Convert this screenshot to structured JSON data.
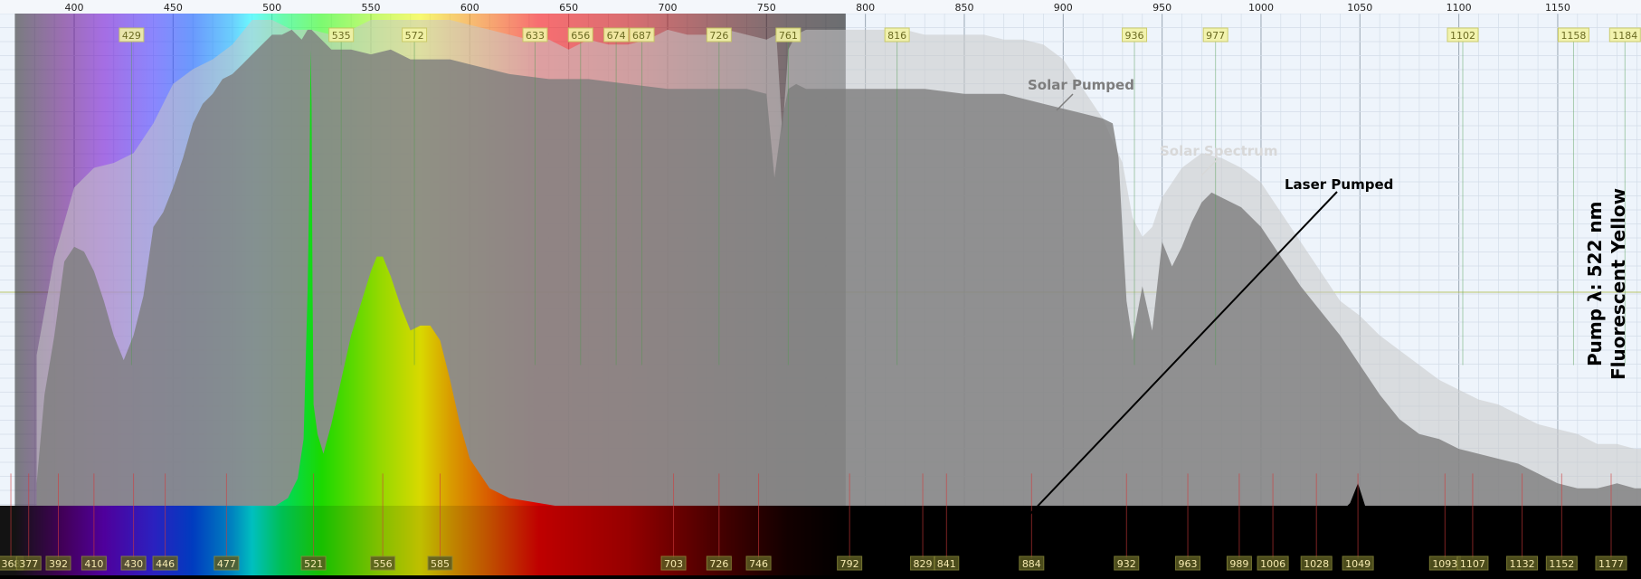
{
  "chart_data": {
    "type": "area",
    "title": "",
    "xlabel": "",
    "ylabel": "",
    "xlim": [
      381,
      1189
    ],
    "ylim": [
      0,
      1
    ],
    "xticks": [
      400,
      450,
      500,
      550,
      600,
      650,
      700,
      750,
      800,
      850,
      900,
      950,
      1000,
      1050,
      1100,
      1150
    ],
    "grid": true,
    "top_peak_labels": [
      429,
      535,
      572,
      633,
      656,
      674,
      687,
      726,
      761,
      816,
      936,
      977,
      1102,
      1158,
      1184
    ],
    "bottom_peak_labels": [
      368,
      377,
      392,
      410,
      430,
      446,
      477,
      521,
      556,
      585,
      703,
      726,
      746,
      792,
      829,
      841,
      884,
      932,
      963,
      989,
      1006,
      1028,
      1049,
      1093,
      1107,
      1132,
      1152,
      1177
    ],
    "series": [
      {
        "name": "Solar Spectrum",
        "color": "#c8c8c8",
        "x": [
          381,
          390,
          400,
          410,
          420,
          430,
          440,
          450,
          460,
          470,
          480,
          490,
          500,
          510,
          520,
          530,
          540,
          550,
          560,
          570,
          580,
          590,
          600,
          610,
          620,
          630,
          640,
          650,
          660,
          670,
          680,
          690,
          700,
          710,
          720,
          730,
          740,
          750,
          755,
          758,
          761,
          765,
          770,
          780,
          790,
          800,
          810,
          820,
          830,
          840,
          850,
          860,
          870,
          880,
          890,
          900,
          910,
          920,
          930,
          935,
          940,
          945,
          950,
          960,
          970,
          980,
          990,
          1000,
          1010,
          1020,
          1030,
          1040,
          1050,
          1060,
          1070,
          1080,
          1090,
          1100,
          1110,
          1120,
          1130,
          1140,
          1150,
          1160,
          1170,
          1180,
          1189
        ],
        "values": [
          0.32,
          0.52,
          0.66,
          0.7,
          0.71,
          0.73,
          0.79,
          0.87,
          0.9,
          0.92,
          0.95,
          1.0,
          1.0,
          0.98,
          0.98,
          0.97,
          0.98,
          1.0,
          1.0,
          1.0,
          1.0,
          1.0,
          0.99,
          0.98,
          0.97,
          0.96,
          0.96,
          0.94,
          0.96,
          0.95,
          0.95,
          0.96,
          0.98,
          0.97,
          0.97,
          0.98,
          0.97,
          0.96,
          0.97,
          0.77,
          0.94,
          0.97,
          0.98,
          0.98,
          0.98,
          0.98,
          0.98,
          0.98,
          0.97,
          0.97,
          0.97,
          0.97,
          0.96,
          0.96,
          0.95,
          0.92,
          0.86,
          0.8,
          0.71,
          0.6,
          0.56,
          0.58,
          0.64,
          0.7,
          0.73,
          0.72,
          0.7,
          0.67,
          0.61,
          0.55,
          0.49,
          0.43,
          0.4,
          0.36,
          0.33,
          0.3,
          0.27,
          0.25,
          0.23,
          0.22,
          0.2,
          0.18,
          0.17,
          0.16,
          0.14,
          0.14,
          0.13
        ]
      },
      {
        "name": "Solar Pumped",
        "color": "#7d7d7d",
        "x": [
          381,
          385,
          390,
          395,
          400,
          405,
          410,
          415,
          420,
          425,
          430,
          435,
          440,
          445,
          450,
          455,
          460,
          465,
          470,
          475,
          480,
          485,
          490,
          495,
          500,
          505,
          510,
          515,
          518,
          520,
          525,
          530,
          540,
          550,
          560,
          570,
          580,
          590,
          600,
          620,
          640,
          660,
          680,
          700,
          720,
          740,
          750,
          754,
          758,
          761,
          765,
          770,
          790,
          810,
          830,
          850,
          870,
          880,
          890,
          900,
          910,
          920,
          925,
          928,
          930,
          932,
          935,
          940,
          945,
          950,
          955,
          960,
          965,
          970,
          975,
          980,
          990,
          1000,
          1010,
          1020,
          1030,
          1040,
          1050,
          1060,
          1070,
          1080,
          1090,
          1100,
          1110,
          1120,
          1130,
          1140,
          1150,
          1160,
          1170,
          1180,
          1189
        ],
        "values": [
          0.06,
          0.24,
          0.36,
          0.51,
          0.54,
          0.53,
          0.49,
          0.43,
          0.36,
          0.31,
          0.36,
          0.44,
          0.58,
          0.61,
          0.66,
          0.72,
          0.79,
          0.83,
          0.85,
          0.88,
          0.89,
          0.91,
          0.93,
          0.95,
          0.97,
          0.97,
          0.98,
          0.96,
          0.98,
          0.98,
          0.96,
          0.94,
          0.94,
          0.93,
          0.94,
          0.92,
          0.92,
          0.92,
          0.91,
          0.89,
          0.88,
          0.88,
          0.87,
          0.86,
          0.86,
          0.86,
          0.85,
          0.68,
          0.8,
          0.86,
          0.87,
          0.86,
          0.86,
          0.86,
          0.86,
          0.85,
          0.85,
          0.84,
          0.83,
          0.82,
          0.81,
          0.8,
          0.79,
          0.72,
          0.57,
          0.43,
          0.35,
          0.46,
          0.37,
          0.55,
          0.5,
          0.54,
          0.59,
          0.63,
          0.65,
          0.64,
          0.62,
          0.58,
          0.52,
          0.46,
          0.41,
          0.36,
          0.3,
          0.24,
          0.19,
          0.16,
          0.15,
          0.13,
          0.12,
          0.11,
          0.1,
          0.08,
          0.06,
          0.05,
          0.05,
          0.06,
          0.05
        ]
      },
      {
        "name": "Laser Pumped",
        "color": "#000000",
        "x": [
          381,
          400,
          450,
          480,
          500,
          508,
          513,
          516,
          518,
          519,
          519.5,
          520,
          520.5,
          521,
          523,
          526,
          530,
          540,
          550,
          553,
          556,
          560,
          565,
          570,
          575,
          580,
          585,
          590,
          595,
          600,
          610,
          620,
          650,
          700,
          750,
          800,
          850,
          900,
          950,
          1000,
          1040,
          1045,
          1049,
          1053,
          1060,
          1100,
          1150,
          1189
        ],
        "values": [
          0.0,
          0.0,
          0.0,
          0.0,
          0.01,
          0.03,
          0.07,
          0.15,
          0.45,
          0.7,
          0.94,
          0.83,
          0.45,
          0.22,
          0.16,
          0.12,
          0.18,
          0.36,
          0.49,
          0.52,
          0.52,
          0.48,
          0.42,
          0.37,
          0.38,
          0.38,
          0.35,
          0.27,
          0.18,
          0.11,
          0.05,
          0.03,
          0.01,
          0.0,
          0.0,
          0.0,
          0.0,
          0.0,
          0.0,
          0.0,
          0.0,
          0.02,
          0.06,
          0.01,
          0.0,
          0.0,
          0.0,
          0.0
        ]
      }
    ],
    "annotations": {
      "laser_pumped": "Laser Pumped",
      "solar_pumped": "Solar Pumped",
      "solar_spectrum": "Solar Spectrum",
      "side_line_1": "Pump λ: 522 nm",
      "side_line_2": "Fluorescent Yellow"
    }
  }
}
